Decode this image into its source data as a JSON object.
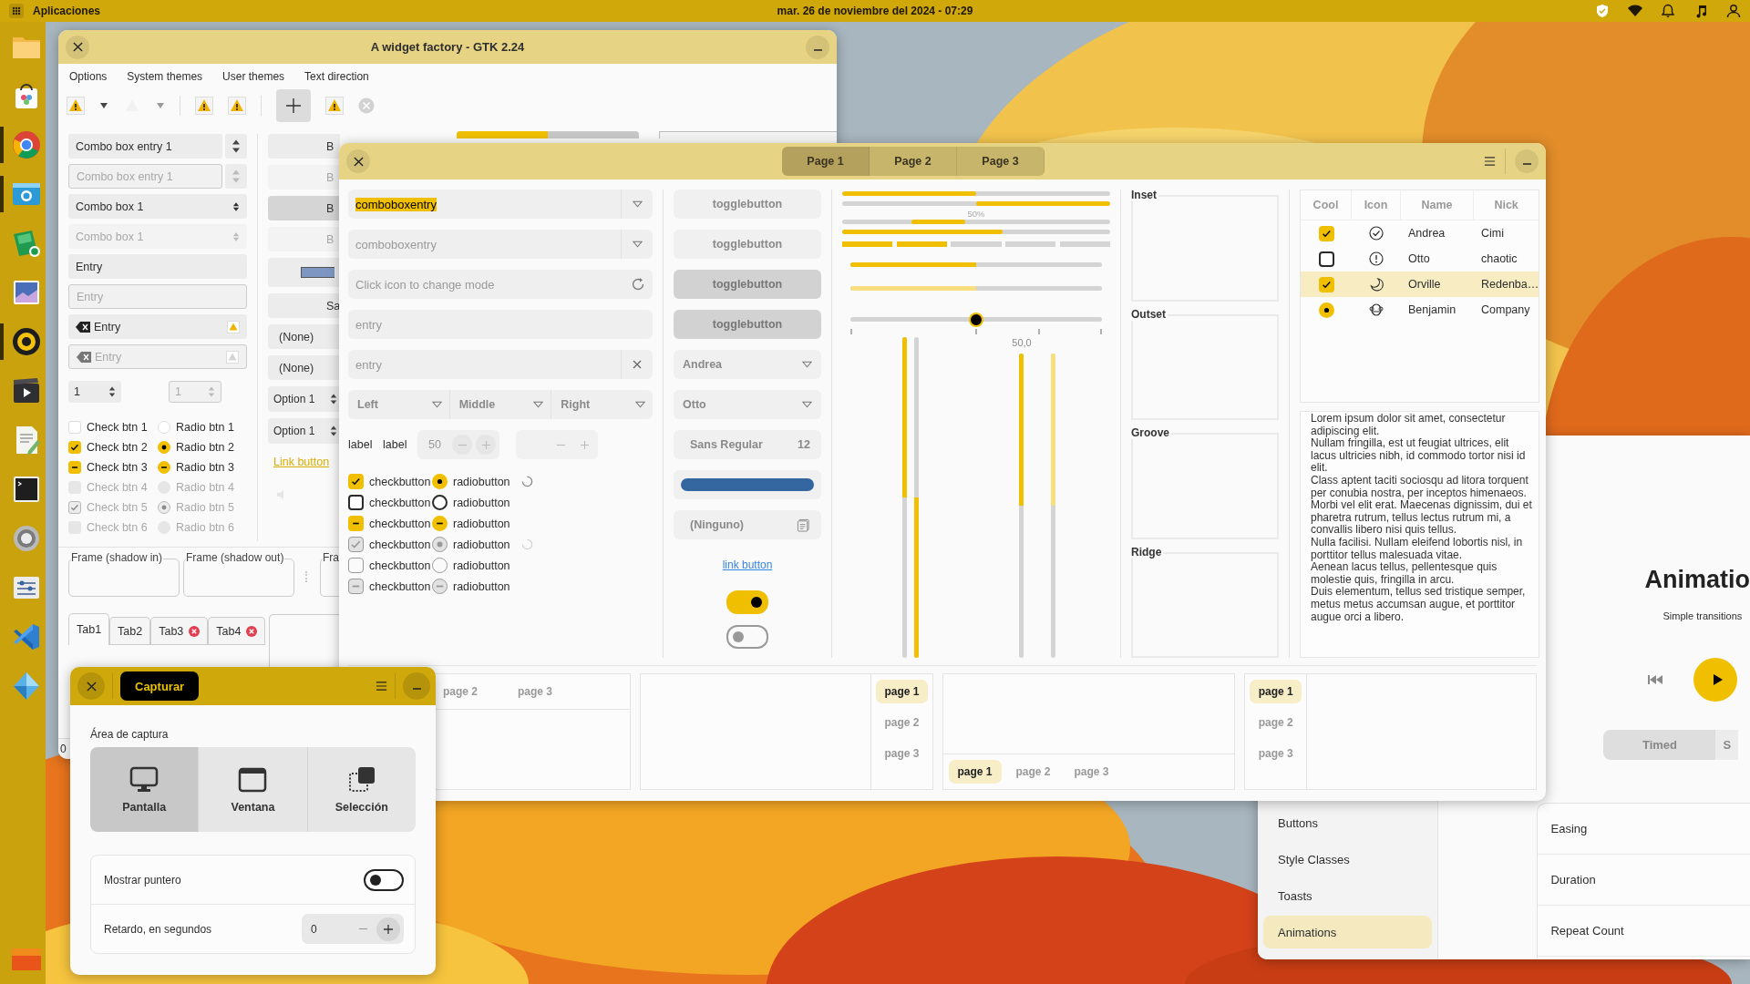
{
  "top_bar": {
    "apps_label": "Aplicaciones",
    "clock": "mar. 26 de noviembre del 2024 - 07:29"
  },
  "dock": [
    {
      "running": false
    },
    {
      "running": false
    },
    {
      "running": true
    },
    {
      "running": true
    },
    {
      "running": false
    },
    {
      "running": false
    },
    {
      "running": true
    },
    {
      "running": false
    },
    {
      "running": false
    },
    {
      "running": false
    },
    {
      "running": false
    },
    {
      "running": false
    },
    {
      "running": false
    },
    {
      "running": false
    },
    {
      "running": false
    }
  ],
  "gtk2_window": {
    "title": "A widget factory - GTK 2.24",
    "menu": [
      "Options",
      "System themes",
      "User themes",
      "Text direction"
    ],
    "entries": [
      {
        "kind": "combo_entry",
        "text": "Combo box entry 1",
        "disabled": false
      },
      {
        "kind": "combo_entry",
        "text": "Combo box entry 1",
        "disabled": true
      },
      {
        "kind": "combo",
        "text": "Combo box 1",
        "disabled": false
      },
      {
        "kind": "combo",
        "text": "Combo box 1",
        "disabled": true
      },
      {
        "kind": "entry",
        "text": "Entry",
        "disabled": false
      },
      {
        "kind": "entry",
        "text": "Entry",
        "disabled": true
      },
      {
        "kind": "icon_entry",
        "text": "Entry",
        "disabled": false
      },
      {
        "kind": "icon_entry",
        "text": "Entry",
        "disabled": true
      }
    ],
    "spins": [
      {
        "value": "1",
        "disabled": false
      },
      {
        "value": "1",
        "disabled": true
      }
    ],
    "check_rows": [
      {
        "check": {
          "label": "Check btn 1",
          "checked": false,
          "mixed": false,
          "disabled": false
        },
        "radio": {
          "label": "Radio btn 1",
          "checked": false,
          "mixed": false,
          "disabled": false
        }
      },
      {
        "check": {
          "label": "Check btn 2",
          "checked": true,
          "mixed": false,
          "disabled": false
        },
        "radio": {
          "label": "Radio btn 2",
          "checked": true,
          "mixed": false,
          "disabled": false
        }
      },
      {
        "check": {
          "label": "Check btn 3",
          "checked": true,
          "mixed": true,
          "disabled": false
        },
        "radio": {
          "label": "Radio btn 3",
          "checked": true,
          "mixed": true,
          "disabled": false
        }
      },
      {
        "check": {
          "label": "Check btn 4",
          "checked": false,
          "mixed": false,
          "disabled": true
        },
        "radio": {
          "label": "Radio btn 4",
          "checked": false,
          "mixed": false,
          "disabled": true
        }
      },
      {
        "check": {
          "label": "Check btn 5",
          "checked": true,
          "mixed": false,
          "disabled": true
        },
        "radio": {
          "label": "Radio btn 5",
          "checked": true,
          "mixed": false,
          "disabled": true
        }
      },
      {
        "check": {
          "label": "Check btn 6",
          "checked": false,
          "mixed": false,
          "disabled": true
        },
        "radio": {
          "label": "Radio btn 6",
          "checked": false,
          "mixed": false,
          "disabled": true
        }
      }
    ],
    "buttons": [
      {
        "kind": "button",
        "text": "B",
        "pressed": false,
        "disabled": false
      },
      {
        "kind": "button",
        "text": "B",
        "pressed": false,
        "disabled": true
      },
      {
        "kind": "button",
        "text": "B",
        "pressed": true,
        "disabled": false
      },
      {
        "kind": "button",
        "text": "B",
        "pressed": false,
        "disabled": true
      },
      {
        "kind": "color"
      },
      {
        "kind": "button",
        "text": "Sa",
        "pressed": false,
        "disabled": false
      },
      {
        "kind": "combo",
        "text": "(None)"
      },
      {
        "kind": "combo",
        "text": "(None)"
      },
      {
        "kind": "option",
        "text": "Option 1"
      },
      {
        "kind": "option",
        "text": "Option 1"
      },
      {
        "kind": "link",
        "text": "Link button"
      },
      {
        "kind": "volume"
      }
    ],
    "progress": {
      "level": 0.5
    },
    "frames": [
      "Frame (shadow in)",
      "Frame (shadow out)",
      "Fra"
    ],
    "tabs": [
      {
        "label": "Tab1",
        "selected": true,
        "closable": false
      },
      {
        "label": "Tab2",
        "selected": false,
        "closable": false
      },
      {
        "label": "Tab3",
        "selected": false,
        "closable": true
      },
      {
        "label": "Tab4",
        "selected": false,
        "closable": true
      }
    ],
    "status": "0"
  },
  "gtk3_window": {
    "tabs": [
      {
        "label": "Page 1",
        "selected": true
      },
      {
        "label": "Page 2",
        "selected": false
      },
      {
        "label": "Page 3",
        "selected": false
      }
    ],
    "combo_entries": [
      {
        "value": "comboboxentry",
        "selected_text": true,
        "disabled": false
      },
      {
        "value": "comboboxentry",
        "selected_text": false,
        "disabled": true
      }
    ],
    "mode_entry": {
      "placeholder": "Click icon to change mode"
    },
    "entries": [
      {
        "placeholder": "entry",
        "clearable": false
      },
      {
        "placeholder": "entry",
        "clearable": true
      }
    ],
    "aligned_combos": [
      "Left",
      "Middle",
      "Right"
    ],
    "labels": [
      "label",
      "label"
    ],
    "spin": {
      "value": "50"
    },
    "check_rows": [
      {
        "check": {
          "label": "checkbutton",
          "checked": true,
          "mixed": false,
          "disabled": false
        },
        "radio": {
          "label": "radiobutton",
          "checked": true,
          "mixed": false,
          "disabled": false
        },
        "spinner": true
      },
      {
        "check": {
          "label": "checkbutton",
          "checked": false,
          "mixed": false,
          "disabled": false
        },
        "radio": {
          "label": "radiobutton",
          "checked": false,
          "mixed": false,
          "disabled": false
        },
        "spinner": false
      },
      {
        "check": {
          "label": "checkbutton",
          "checked": true,
          "mixed": true,
          "disabled": false
        },
        "radio": {
          "label": "radiobutton",
          "checked": true,
          "mixed": true,
          "disabled": false
        },
        "spinner": false
      },
      {
        "check": {
          "label": "checkbutton",
          "checked": true,
          "mixed": false,
          "disabled": true
        },
        "radio": {
          "label": "radiobutton",
          "checked": true,
          "mixed": false,
          "disabled": true
        },
        "spinner": true
      },
      {
        "check": {
          "label": "checkbutton",
          "checked": false,
          "mixed": false,
          "disabled": true
        },
        "radio": {
          "label": "radiobutton",
          "checked": false,
          "mixed": false,
          "disabled": true
        },
        "spinner": false
      },
      {
        "check": {
          "label": "checkbutton",
          "checked": true,
          "mixed": true,
          "disabled": true
        },
        "radio": {
          "label": "radiobutton",
          "checked": true,
          "mixed": true,
          "disabled": true
        },
        "spinner": false
      }
    ],
    "toggle_buttons": [
      {
        "label": "togglebutton",
        "pressed": false
      },
      {
        "label": "togglebutton",
        "pressed": false
      },
      {
        "label": "togglebutton",
        "pressed": true
      },
      {
        "label": "togglebutton",
        "pressed": true
      }
    ],
    "combos": [
      "Andrea",
      "Otto"
    ],
    "font_button": {
      "name": "Sans Regular",
      "size": "12"
    },
    "file_button": {
      "text": "(Ninguno)"
    },
    "link": "link button",
    "switches": [
      {
        "on": true
      },
      {
        "on": false
      }
    ],
    "progress_bars": [
      {
        "level": 0.5,
        "inverted": false
      },
      {
        "level": 0.5,
        "inverted": true
      }
    ],
    "activity_bar": {
      "text": "50%"
    },
    "progress_bar": {
      "level": 0.6
    },
    "level_bar": {
      "level": 0.4
    },
    "scales": [
      {
        "level": 0.5,
        "disabled": false
      },
      {
        "level": 0.5,
        "disabled": true
      }
    ],
    "slider": {
      "level": 0.5,
      "reading": "50,0"
    },
    "vscales": [
      {
        "level": 0.5,
        "inverted": false,
        "disabled": false
      },
      {
        "level": 0.5,
        "inverted": true,
        "disabled": false
      },
      {
        "level": 0.5,
        "inverted": false,
        "disabled": false
      },
      {
        "level": 0.5,
        "inverted": false,
        "disabled": true
      }
    ],
    "frames": [
      "Inset",
      "Outset",
      "Groove",
      "Ridge"
    ],
    "tree": {
      "columns": [
        "Cool",
        "Icon",
        "Name",
        "Nick"
      ],
      "rows": [
        {
          "kind": "check",
          "checked": true,
          "name": "Andrea",
          "nick": "Cimi",
          "selected": false
        },
        {
          "kind": "check",
          "checked": false,
          "name": "Otto",
          "nick": "chaotic",
          "selected": false
        },
        {
          "kind": "check",
          "checked": true,
          "name": "Orville",
          "nick": "Redenba…",
          "selected": true
        },
        {
          "kind": "radio",
          "checked": true,
          "name": "Benjamin",
          "nick": "Company",
          "selected": false
        }
      ]
    },
    "text_view": [
      "Lorem ipsum dolor sit amet, consectetur adipiscing elit.",
      "Nullam fringilla, est ut feugiat ultrices, elit lacus ultricies nibh, id commodo tortor nisi id elit.",
      "Class aptent taciti sociosqu ad litora torquent per conubia nostra, per inceptos himenaeos.",
      "Morbi vel elit erat. Maecenas dignissim, dui et pharetra rutrum, tellus lectus rutrum mi, a convallis libero nisi quis tellus.",
      "Nulla facilisi. Nullam eleifend lobortis nisl, in porttitor tellus malesuada vitae.",
      "Aenean lacus tellus, pellentesque quis molestie quis, fringilla in arcu.",
      "Duis elementum, tellus sed tristique semper, metus metus accumsan augue, et porttitor augue orci a libero."
    ],
    "notebooks": [
      {
        "kind": "top",
        "tabs": [
          {
            "label": "page 2",
            "selected": false
          },
          {
            "label": "page 3",
            "selected": false
          }
        ]
      },
      {
        "kind": "right",
        "tabs": [
          {
            "label": "page 1",
            "selected": true
          },
          {
            "label": "page 2",
            "selected": false
          },
          {
            "label": "page 3",
            "selected": false
          }
        ]
      },
      {
        "kind": "bottom",
        "tabs": [
          {
            "label": "page 1",
            "selected": true
          },
          {
            "label": "page 2",
            "selected": false
          },
          {
            "label": "page 3",
            "selected": false
          }
        ]
      },
      {
        "kind": "left",
        "tabs": [
          {
            "label": "page 1",
            "selected": true
          },
          {
            "label": "page 2",
            "selected": false
          },
          {
            "label": "page 3",
            "selected": false
          }
        ]
      }
    ]
  },
  "capture_dialog": {
    "title_button": "Capturar",
    "area_label": "Área de captura",
    "modes": [
      {
        "label": "Pantalla",
        "selected": true
      },
      {
        "label": "Ventana",
        "selected": false
      },
      {
        "label": "Selección",
        "selected": false
      }
    ],
    "pointer": {
      "label": "Mostrar puntero",
      "on": false
    },
    "delay": {
      "label": "Retardo, en segundos",
      "value": "0"
    }
  },
  "animations_window": {
    "sidebar": [
      {
        "label": "Buttons",
        "selected": false
      },
      {
        "label": "Style Classes",
        "selected": false
      },
      {
        "label": "Toasts",
        "selected": false
      },
      {
        "label": "Animations",
        "selected": true
      }
    ],
    "title": "Animatio",
    "subtitle": "Simple transitions",
    "modes": [
      {
        "label": "Timed",
        "selected": true
      },
      {
        "label": "S",
        "selected": false
      }
    ],
    "settings": [
      "Easing",
      "Duration",
      "Repeat Count"
    ]
  }
}
